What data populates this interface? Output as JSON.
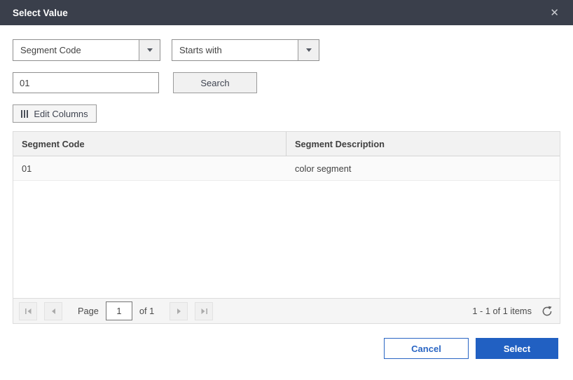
{
  "dialog": {
    "title": "Select Value",
    "close_icon": "✕"
  },
  "filters": {
    "column_dropdown": {
      "value": "Segment Code"
    },
    "operator_dropdown": {
      "value": "Starts with"
    },
    "search_input": {
      "value": "01"
    },
    "search_button_label": "Search",
    "edit_columns_label": "Edit Columns"
  },
  "table": {
    "columns": [
      "Segment Code",
      "Segment Description"
    ],
    "rows": [
      [
        "01",
        "color segment"
      ]
    ]
  },
  "pager": {
    "page_label": "Page",
    "page_value": "1",
    "of_label": "of 1",
    "items_info": "1 - 1 of 1 items"
  },
  "footer": {
    "cancel_label": "Cancel",
    "select_label": "Select"
  },
  "colors": {
    "titlebar_bg": "#3a3f4b",
    "accent_blue": "#2160c2",
    "control_border": "#8f8f8f",
    "grid_header_bg": "#f2f2f2",
    "row_bg": "#fafafa"
  }
}
